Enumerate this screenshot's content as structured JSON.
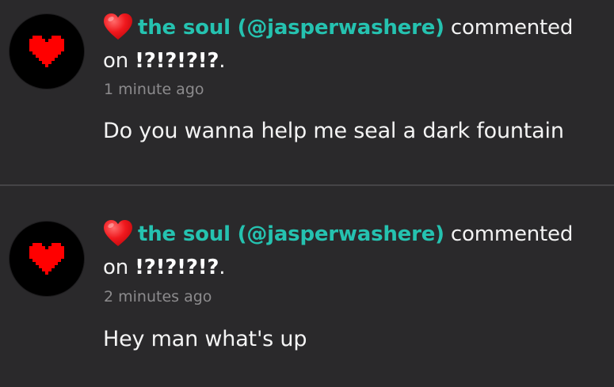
{
  "notifications": [
    {
      "emoji": "red-heart",
      "user_display": "the soul (@jasperwashere)",
      "action": "commented",
      "preposition": "on",
      "target": "!?!?!?!?",
      "punctuation": ".",
      "timestamp": "1 minute ago",
      "comment": "Do you wanna help me seal a dark fountain"
    },
    {
      "emoji": "red-heart",
      "user_display": "the soul (@jasperwashere)",
      "action": "commented",
      "preposition": "on",
      "target": "!?!?!?!?",
      "punctuation": ".",
      "timestamp": "2 minutes ago",
      "comment": "Hey man what's up"
    }
  ],
  "colors": {
    "background": "#2a292b",
    "username": "#25c2b0",
    "timestamp": "#8c8b8d",
    "avatar_heart": "#ff0000",
    "divider": "#454447"
  },
  "icons": {
    "avatar": "pixel-heart-icon",
    "emoji": "red-heart-emoji-icon"
  }
}
